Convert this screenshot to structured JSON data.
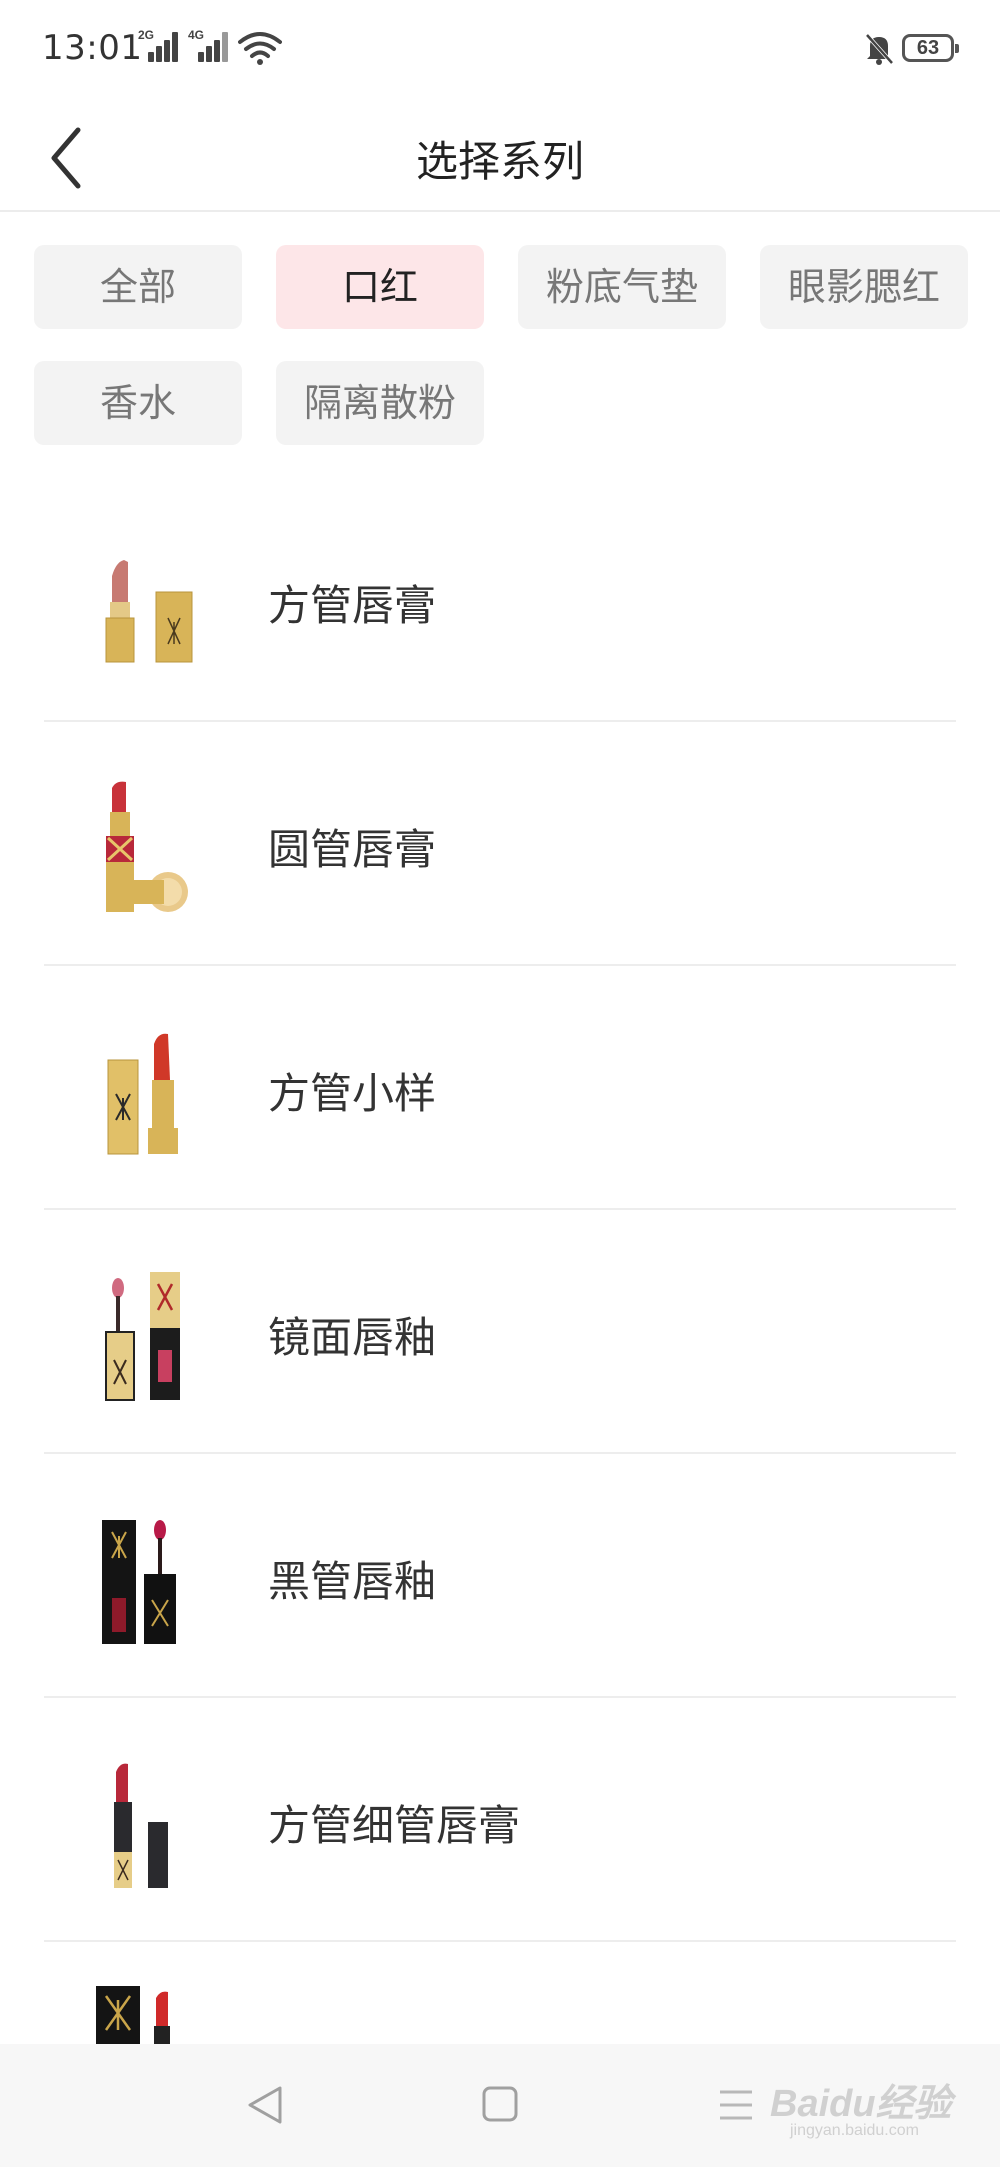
{
  "status_bar": {
    "time": "13:01",
    "network_1": "2G",
    "network_2": "4G",
    "battery": "63"
  },
  "header": {
    "title": "选择系列"
  },
  "tabs": [
    {
      "label": "全部",
      "active": false
    },
    {
      "label": "口红",
      "active": true
    },
    {
      "label": "粉底气垫",
      "active": false
    },
    {
      "label": "眼影腮红",
      "active": false
    },
    {
      "label": "香水",
      "active": false
    },
    {
      "label": "隔离散粉",
      "active": false
    }
  ],
  "series_list": [
    {
      "label": "方管唇膏",
      "image": "square-tube-lipstick"
    },
    {
      "label": "圆管唇膏",
      "image": "round-tube-lipstick"
    },
    {
      "label": "方管小样",
      "image": "mini-square-lipstick"
    },
    {
      "label": "镜面唇釉",
      "image": "glossy-lip-glaze"
    },
    {
      "label": "黑管唇釉",
      "image": "black-tube-lip-glaze"
    },
    {
      "label": "方管细管唇膏",
      "image": "slim-square-lipstick"
    },
    {
      "label": "",
      "image": "black-box-lipstick"
    }
  ],
  "watermark": {
    "text": "Baidu经验",
    "sub": "jingyan.baidu.com"
  },
  "colors": {
    "active_chip_bg": "#fde6e8",
    "chip_bg": "#f3f3f3",
    "gold": "#d8b458",
    "lipstick_red": "#c8323a"
  }
}
